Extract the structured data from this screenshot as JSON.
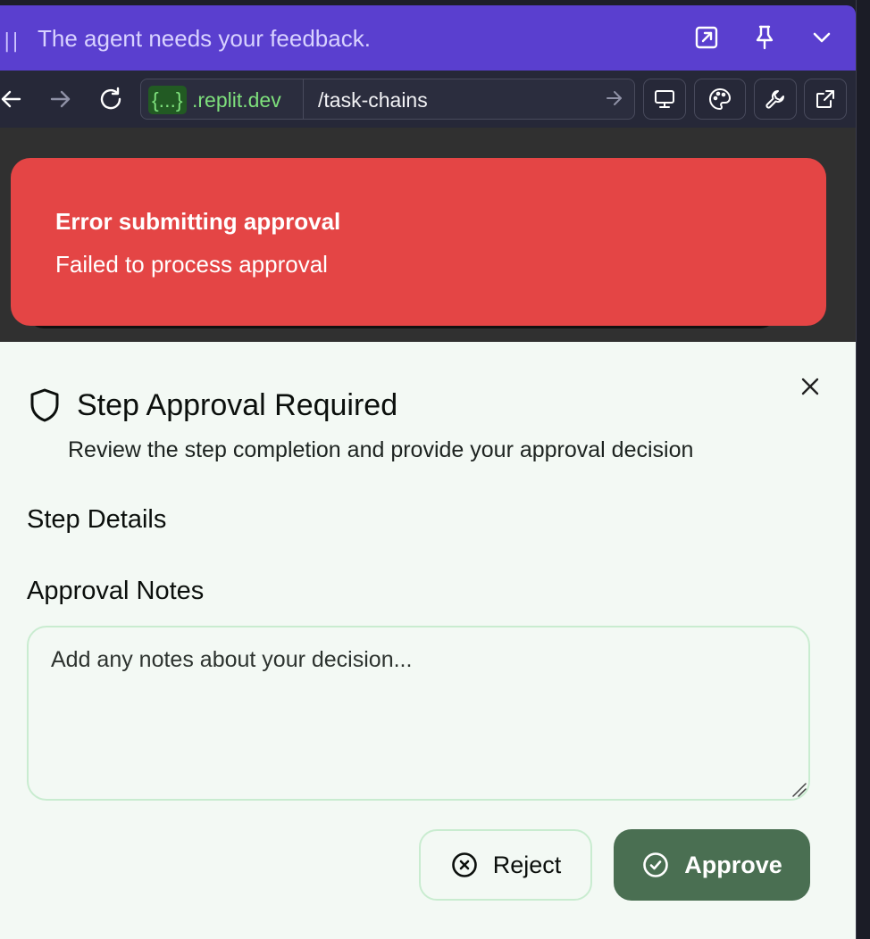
{
  "agent_bar": {
    "message": "The agent needs your feedback.",
    "icons": [
      "grip-icon",
      "expand-icon",
      "pin-icon",
      "chevron-down-icon"
    ]
  },
  "browser": {
    "url_domain_token": "{...}",
    "url_domain_rest": ".replit.dev",
    "url_path": "/task-chains",
    "nav_icons": [
      "back-icon",
      "forward-icon",
      "reload-icon"
    ],
    "tool_icons": [
      "monitor-icon",
      "palette-icon",
      "wrench-icon",
      "external-link-icon"
    ]
  },
  "toast": {
    "title": "Error submitting approval",
    "message": "Failed to process approval",
    "color": "#e44545"
  },
  "dialog": {
    "title": "Step Approval Required",
    "description": "Review the step completion and provide your approval decision",
    "section_step_details": "Step Details",
    "section_approval_notes": "Approval Notes",
    "notes_placeholder": "Add any notes about your decision...",
    "notes_value": "",
    "reject_label": "Reject",
    "approve_label": "Approve",
    "approve_color": "#4a6f52",
    "accent_border": "#c9ecd0"
  }
}
